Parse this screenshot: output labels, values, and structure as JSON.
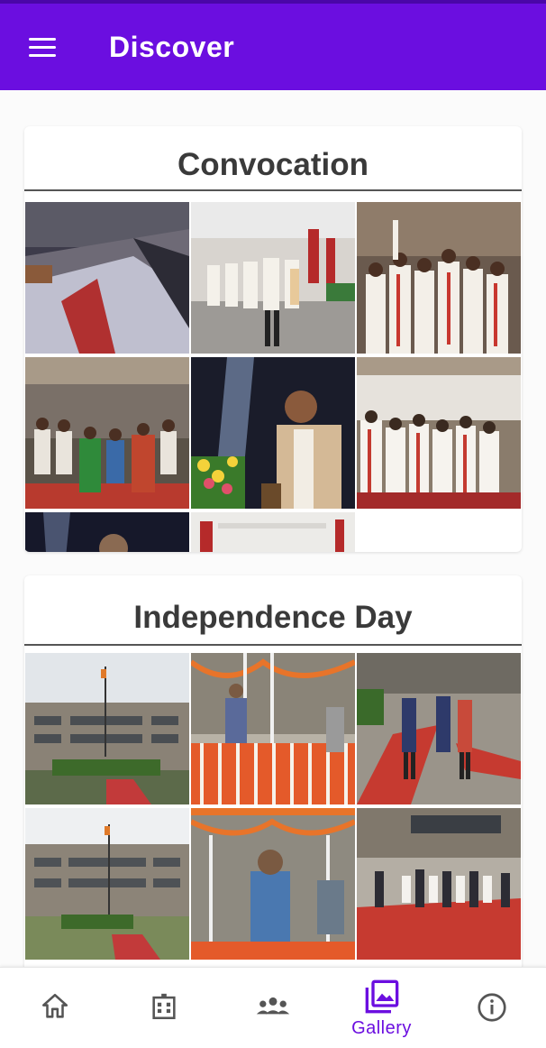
{
  "app_bar": {
    "title": "Discover",
    "menu_icon": "hamburger-menu-icon"
  },
  "sections": [
    {
      "title": "Convocation",
      "photos": [
        {
          "name": "auditorium-wide-view"
        },
        {
          "name": "graduates-procession"
        },
        {
          "name": "graduates-celebrating"
        },
        {
          "name": "audience-dignitaries"
        },
        {
          "name": "speaker-at-podium"
        },
        {
          "name": "graduates-standing"
        },
        {
          "name": "stage-partial"
        },
        {
          "name": "hall-partial"
        }
      ]
    },
    {
      "title": "Independence Day",
      "photos": [
        {
          "name": "building-flag-courtyard"
        },
        {
          "name": "flag-hoisting-dais"
        },
        {
          "name": "officials-red-carpet"
        },
        {
          "name": "building-flagpole"
        },
        {
          "name": "speaker-microphone"
        },
        {
          "name": "guard-of-honour"
        }
      ]
    }
  ],
  "bottom_nav": {
    "items": [
      {
        "icon": "home-icon",
        "label": ""
      },
      {
        "icon": "building-icon",
        "label": ""
      },
      {
        "icon": "people-icon",
        "label": ""
      },
      {
        "icon": "gallery-icon",
        "label": "Gallery",
        "active": true
      },
      {
        "icon": "info-icon",
        "label": ""
      }
    ]
  },
  "colors": {
    "primary": "#6b0ee0",
    "icon": "#555555"
  }
}
